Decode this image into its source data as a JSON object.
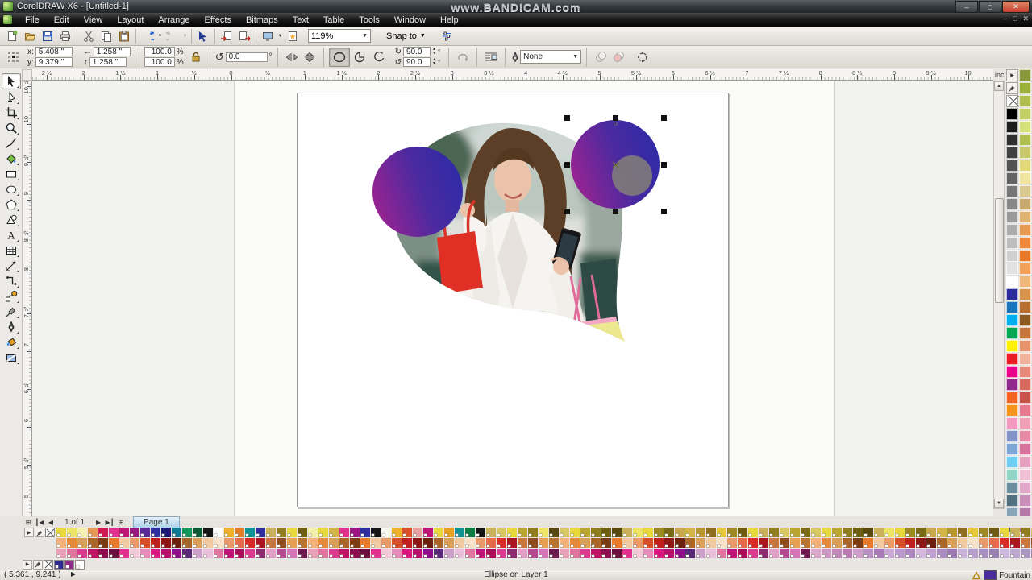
{
  "window": {
    "title": "CorelDRAW X6 - [Untitled-1]",
    "watermark": "www.BANDICAM.com"
  },
  "menu": {
    "items": [
      "File",
      "Edit",
      "View",
      "Layout",
      "Arrange",
      "Effects",
      "Bitmaps",
      "Text",
      "Table",
      "Tools",
      "Window",
      "Help"
    ]
  },
  "toolbar": {
    "zoom_level": "119%",
    "snap_label": "Snap to"
  },
  "prop": {
    "x_label": "x:",
    "x_value": "5.408 \"",
    "y_label": "y:",
    "y_value": "9.379 \"",
    "w_value": "1.258 \"",
    "h_value": "1.258 \"",
    "scale_x": "100.0",
    "scale_y": "100.0",
    "percent": "%",
    "rotation": "0.0",
    "degree": "°",
    "arc_start": "90.0",
    "arc_end": "90.0",
    "outline_value": "None"
  },
  "rulers": {
    "unit": "inches",
    "top_labels": [
      "2 ½",
      "2",
      "1 ½",
      "1",
      "½",
      "0",
      "½",
      "1",
      "1 ½",
      "2",
      "2 ½",
      "3",
      "3 ½",
      "4",
      "4 ½",
      "5",
      "5 ½",
      "6",
      "6 ½",
      "7",
      "7 ½",
      "8",
      "8 ½",
      "9",
      "9 ½",
      "10"
    ],
    "left_labels": [
      "10 ½",
      "10",
      "9 ½",
      "9",
      "8 ½",
      "8",
      "7 ½",
      "7",
      "6 ½",
      "6",
      "5 ½",
      "5"
    ]
  },
  "toolbox": {
    "tools": [
      {
        "name": "pick-tool",
        "selected": true
      },
      {
        "name": "shape-tool",
        "selected": false
      },
      {
        "name": "crop-tool",
        "selected": false
      },
      {
        "name": "zoom-tool",
        "selected": false
      },
      {
        "name": "freehand-tool",
        "selected": false
      },
      {
        "name": "smart-fill-tool",
        "selected": false
      },
      {
        "name": "rectangle-tool",
        "selected": false
      },
      {
        "name": "ellipse-tool",
        "selected": false
      },
      {
        "name": "polygon-tool",
        "selected": false
      },
      {
        "name": "basic-shapes-tool",
        "selected": false
      },
      {
        "name": "text-tool",
        "selected": false
      },
      {
        "name": "table-tool",
        "selected": false
      },
      {
        "name": "dimension-tool",
        "selected": false
      },
      {
        "name": "connector-tool",
        "selected": false
      },
      {
        "name": "blend-tool",
        "selected": false
      },
      {
        "name": "eyedropper-tool",
        "selected": false
      },
      {
        "name": "outline-pen-tool",
        "selected": false
      },
      {
        "name": "fill-tool",
        "selected": false
      },
      {
        "name": "interactive-fill-tool",
        "selected": false
      }
    ]
  },
  "page": {
    "nav_text": "1 of 1",
    "tab": "Page 1"
  },
  "status": {
    "coords": "( 5.361 , 9.241 )",
    "object": "Ellipse on Layer 1",
    "fill_label": "Fountain",
    "fill_color": "#4b2aa0"
  },
  "artwork": {
    "gradient_start": "#9b2390",
    "gradient_mid": "#4b2aa0",
    "gradient_end": "#2e2ba6",
    "gray_circle": "#7e787c"
  },
  "palettes": {
    "right_col_a": [
      "#000000",
      "#1c1c1c",
      "#2e2e2e",
      "#404040",
      "#525252",
      "#646464",
      "#767676",
      "#888888",
      "#9a9a9a",
      "#acacac",
      "#bebebe",
      "#d0d0d0",
      "#e2e2e2",
      "#ffffff",
      "#2b2b9e",
      "#1b75bc",
      "#00aeef",
      "#00a651",
      "#fff200",
      "#ed1c24",
      "#ec008c",
      "#92278f",
      "#f26522",
      "#f7941d",
      "#f49ac1",
      "#8393ca",
      "#7da7d9",
      "#6dcff6",
      "#8fd6c7",
      "#6b8f9e",
      "#52707e",
      "#88a5b8",
      "#44606e"
    ],
    "right_col_b": [
      "#8a9a3a",
      "#9cb03c",
      "#aebf4e",
      "#c1d163",
      "#d4e27a",
      "#b0c050",
      "#c9c96a",
      "#e2d978",
      "#f0e6a0",
      "#d9c98f",
      "#c9a96e",
      "#e2b270",
      "#e89a50",
      "#ef8a3c",
      "#e87a2a",
      "#f2a05a",
      "#efb879",
      "#d9934a",
      "#b86e2e",
      "#8f5a20",
      "#c9763c",
      "#e8936a",
      "#f2b29a",
      "#e8897a",
      "#d96a5e",
      "#c9524a",
      "#e87a8f",
      "#f2a0b8",
      "#e889a8",
      "#d9739e",
      "#e8a0c0",
      "#f2c0d4",
      "#e2a8c9",
      "#c98fb8",
      "#b87aa8",
      "#a86898"
    ],
    "document_colors": [
      "#2e2b8f",
      "#8c2d86",
      "#ffffff"
    ],
    "bottom_rows": [
      [
        "#e7d93c",
        "#efe565",
        "#f4f0ad",
        "#e59a55",
        "#d21a56",
        "#e2308e",
        "#c01577",
        "#9a1580",
        "#5b2a96",
        "#2e2e9e",
        "#191975",
        "#0e7a93",
        "#12965c",
        "#0c5a33",
        "#151515",
        "#ffffff",
        "#efb02a",
        "#e77d22",
        "#109393",
        "#2e2e9e",
        "#c9b25b",
        "#8f7d1d",
        "#e7d93c",
        "#6e5e12",
        "#f4f0ad",
        "#e7d93c",
        "#d2b544",
        "#e2308e",
        "#9a1580",
        "#2e2e9e",
        "#151515",
        "#f7f7f2",
        "#efb02a",
        "#d94f2a",
        "#e8a0a0",
        "#c01577",
        "#e7d93c",
        "#e8a020",
        "#109393",
        "#0c7a43",
        "#151515",
        "#c9b25b",
        "#d9c963",
        "#e7d93c",
        "#b8a62e",
        "#8f7d1d",
        "#efe565",
        "#56480e",
        "#d9c963",
        "#e7d93c",
        "#b8a62e",
        "#8f7d1d",
        "#6e5e12",
        "#56480e",
        "#c9b25b",
        "#efe565",
        "#e7d93c",
        "#9a8a20",
        "#7a6a15",
        "#caa94e",
        "#d2b544",
        "#b8962e",
        "#8f6e1d",
        "#e7c93c",
        "#a08a24",
        "#6e5a12",
        "#e7d93c",
        "#c9b25b",
        "#8f7d1d",
        "#d9c963",
        "#b8a62e",
        "#7a6a15",
        "#d9c963",
        "#e7d93c",
        "#b8a62e",
        "#8f7d1d",
        "#6e5e12",
        "#56480e",
        "#c9b25b",
        "#efe565",
        "#e7d93c",
        "#9a8a20",
        "#7a6a15",
        "#caa94e",
        "#d2b544",
        "#b8962e",
        "#8f6e1d",
        "#e7c93c",
        "#a08a24",
        "#6e5a12",
        "#e7d93c",
        "#c9b25b",
        "#8f7d1d",
        "#d9c963",
        "#b8a62e",
        "#7a6a15"
      ],
      [
        "#f2b27a",
        "#e88a3c",
        "#d9a05a",
        "#a9652a",
        "#7a3c14",
        "#e87a2a",
        "#f2c9a0",
        "#e89a6a",
        "#d94f2a",
        "#c01f1f",
        "#8f1515",
        "#6e200e",
        "#a9652a",
        "#d9a05a",
        "#f2c9a0",
        "#f7e2c9",
        "#e89a6a",
        "#e76a4a",
        "#d92a2a",
        "#a91520",
        "#c9763c",
        "#8f4a1d",
        "#e8a055",
        "#b8742e",
        "#f2b27a",
        "#e88a3c",
        "#d9a05a",
        "#a9652a",
        "#7a3c14",
        "#e87a2a",
        "#f2c9a0",
        "#e89a6a",
        "#d94f2a",
        "#c01f1f",
        "#8f1515",
        "#6e200e",
        "#a9652a",
        "#d9a05a",
        "#f2c9a0",
        "#f7e2c9",
        "#e89a6a",
        "#e76a4a",
        "#d92a2a",
        "#a91520",
        "#c9763c",
        "#8f4a1d",
        "#e8a055",
        "#b8742e",
        "#f2b27a",
        "#e88a3c",
        "#d9a05a",
        "#a9652a",
        "#7a3c14",
        "#e87a2a",
        "#f2c9a0",
        "#e89a6a",
        "#d94f2a",
        "#c01f1f",
        "#8f1515",
        "#6e200e",
        "#a9652a",
        "#d9a05a",
        "#f2c9a0",
        "#f7e2c9",
        "#e89a6a",
        "#e76a4a",
        "#d92a2a",
        "#a91520",
        "#c9763c",
        "#8f4a1d",
        "#e8a055",
        "#b8742e",
        "#f2b27a",
        "#e88a3c",
        "#d9a05a",
        "#a9652a",
        "#7a3c14",
        "#e87a2a",
        "#f2c9a0",
        "#e89a6a",
        "#d94f2a",
        "#c01f1f",
        "#8f1515",
        "#6e200e",
        "#a9652a",
        "#d9a05a",
        "#f2c9a0",
        "#f7e2c9",
        "#e89a6a",
        "#e76a4a",
        "#d92a2a",
        "#a91520",
        "#c9763c",
        "#8f4a1d"
      ],
      [
        "#e8a0b8",
        "#e2739e",
        "#d93c8e",
        "#c01567",
        "#8f0e4f",
        "#6e0e3c",
        "#e2308e",
        "#f2c9d9",
        "#e88ab8",
        "#d9157e",
        "#b80e6e",
        "#8f0e8f",
        "#5b2a77",
        "#caa0c9",
        "#e8c0d9",
        "#e2739e",
        "#c01577",
        "#a90e5b",
        "#d93c8e",
        "#8f2a6e",
        "#e2a0c9",
        "#b8488f",
        "#d973b8",
        "#6e1a4f",
        "#e8a0b8",
        "#e2739e",
        "#d93c8e",
        "#c01567",
        "#8f0e4f",
        "#6e0e3c",
        "#e2308e",
        "#f2c9d9",
        "#e88ab8",
        "#d9157e",
        "#b80e6e",
        "#8f0e8f",
        "#5b2a77",
        "#caa0c9",
        "#e8c0d9",
        "#e2739e",
        "#c01577",
        "#a90e5b",
        "#d93c8e",
        "#8f2a6e",
        "#e2a0c9",
        "#b8488f",
        "#d973b8",
        "#6e1a4f",
        "#e8a0b8",
        "#e2739e",
        "#d93c8e",
        "#c01567",
        "#8f0e4f",
        "#6e0e3c",
        "#e2308e",
        "#f2c9d9",
        "#e88ab8",
        "#d9157e",
        "#b80e6e",
        "#8f0e8f",
        "#5b2a77",
        "#caa0c9",
        "#e8c0d9",
        "#e2739e",
        "#c01577",
        "#a90e5b",
        "#d93c8e",
        "#8f2a6e",
        "#e2a0c9",
        "#b8488f",
        "#d973b8",
        "#6e1a4f",
        "#d9a8cc",
        "#cc96c2",
        "#c089b8",
        "#b87ab0",
        "#cc9ec9",
        "#b890c2",
        "#a87ab8",
        "#c9a8d4",
        "#bb99cc",
        "#ad88c0",
        "#d4b8dd",
        "#c0a0d0",
        "#ab8cc0",
        "#9979b0",
        "#c9b2d9",
        "#b8a0cc",
        "#a890c0",
        "#9880b0",
        "#ccb8dd",
        "#bda8d0",
        "#ab96c2",
        "#9a85b5"
      ]
    ]
  }
}
